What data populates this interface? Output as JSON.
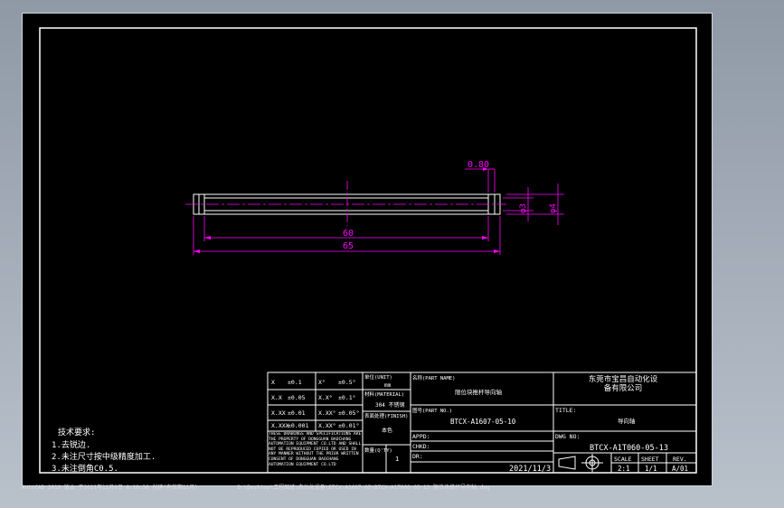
{
  "colors": {
    "frame": "#ffffff",
    "part": "#ffffff",
    "dim": "#ff00ff",
    "bg": "#000000",
    "window": "#a8b0bb"
  },
  "dimensions": {
    "chamfer": "0.80",
    "length_inner": "60",
    "length_total": "65",
    "dia_small": "φ3",
    "dia_big": "φ4"
  },
  "notes": {
    "title": "技术要求:",
    "n1": "1.去锐边.",
    "n2": "2.未注尺寸按中级精度加工.",
    "n3": "3.未注倒角C0.5."
  },
  "tolerance": {
    "rows": [
      [
        "X",
        "±0.1",
        "X°",
        "±0.5°"
      ],
      [
        "X.X",
        "±0.05",
        "X.X°",
        "±0.1°"
      ],
      [
        "X.XX",
        "±0.01",
        "X.XX°",
        "±0.05°"
      ],
      [
        "X.XXX",
        "±0.001",
        "X.XX°",
        "±0.01°"
      ]
    ],
    "unit_label": "单位(UNIT)",
    "unit_value": "mm",
    "material_label": "材料(MATERIAL)",
    "material_value": "304 不锈钢",
    "finish_label": "表面处理(FINISH)",
    "finish_value": "本色",
    "qty_label": "数量(Q'TY)",
    "qty_value": "1",
    "disclaimer": "THESE DRAWINGS AND SPECIFICATIONS ARE THE PROPERTY OF DONGGUAN BAOCHANG AUTOMATION EQUIPMENT CO.LTD AND SHALL NOT BE REPRODUCED COPIED OR USED IN ANY MANNER WITHOUT THE PRIOR WRITTEN CONSENT OF DONGGUAN BAOCHANG AUTOMATION EQUIPMENT CO.LTD"
  },
  "titleblock": {
    "name_label": "名称(PART NAME)",
    "name_value": "限位块推杆导向轴",
    "partno_label": "图号(PART NO.)",
    "partno_value": "BTCX-A1607-05-10",
    "appd_label": "APPD:",
    "chkd_label": "CHKD:",
    "dr_label": "DR:",
    "date": "2021/11/3",
    "company": "东莞市宝昌自动化设备有限公司",
    "title_label": "TITLE:",
    "title_value": "导向轴",
    "dwgno_label": "DWG NO:",
    "dwgno_value": "BTCX-A1T060-05-13",
    "scale_label": "SCALE",
    "scale_value": "2:1",
    "sheet_label": "SHEET",
    "sheet_value": "1/1",
    "rev_label": "REV.",
    "rev_value": "A/01"
  },
  "status": {
    "left": "AutoCAD 2018  版本 于2021年11月9日 8:10:36 创建(有效期11月)",
    "path": "D:\\Desktop\\工程图纸\\自动化设备\\BTCX-A1607-05\\BTCX-A1T060-05-13 限位块推杆导向轴.dwg"
  }
}
